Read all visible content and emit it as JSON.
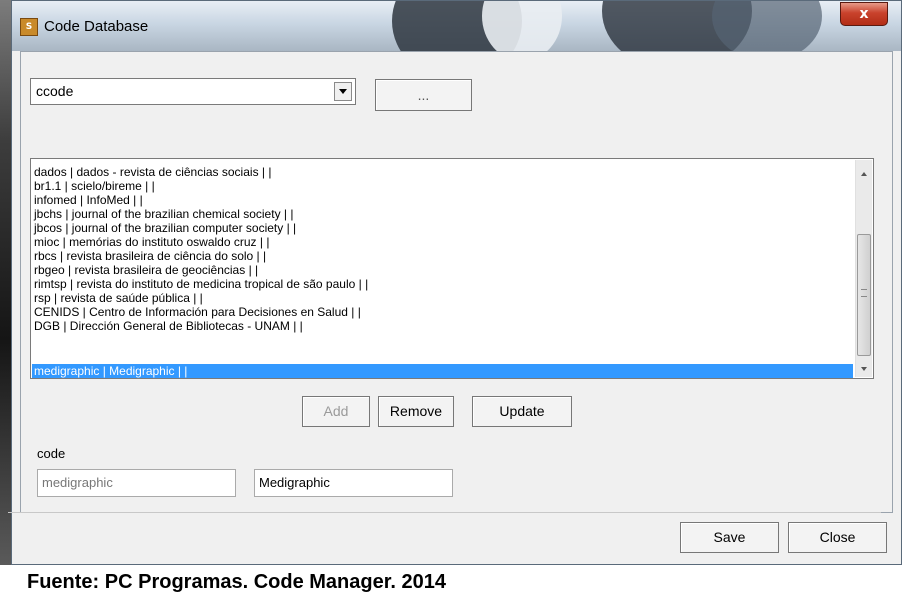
{
  "window": {
    "title": "Code Database",
    "close_label": "x"
  },
  "selector": {
    "value": "ccode",
    "ellipsis_button_label": "..."
  },
  "list": {
    "items": [
      "dados | dados - revista de ciências sociais | |",
      "br1.1 | scielo/bireme | |",
      "infomed | InfoMed | |",
      "jbchs | journal of the brazilian chemical society | |",
      "jbcos | journal of the brazilian computer society | |",
      "mioc | memórias do instituto oswaldo cruz | |",
      "rbcs | revista brasileira de ciência do solo | |",
      "rbgeo | revista brasileira de geociências | |",
      "rimtsp | revista do instituto de medicina tropical de são paulo | |",
      "rsp | revista de saúde pública | |",
      "CENIDS | Centro de Información para Decisiones en Salud | |",
      "DGB | Dirección General de Bibliotecas - UNAM | |",
      "medigraphic | Medigraphic | |"
    ],
    "selected_item": "medigraphic | Medigraphic | |"
  },
  "actions": {
    "add_label": "Add",
    "remove_label": "Remove",
    "update_label": "Update"
  },
  "code_form": {
    "label": "code",
    "code_value": "medigraphic",
    "name_value": "Medigraphic"
  },
  "footer": {
    "save_label": "Save",
    "close_label": "Close"
  },
  "caption": "Fuente: PC Programas. Code Manager. 2014",
  "colors": {
    "selection": "#3399ff",
    "close_button": "#c9422c"
  }
}
